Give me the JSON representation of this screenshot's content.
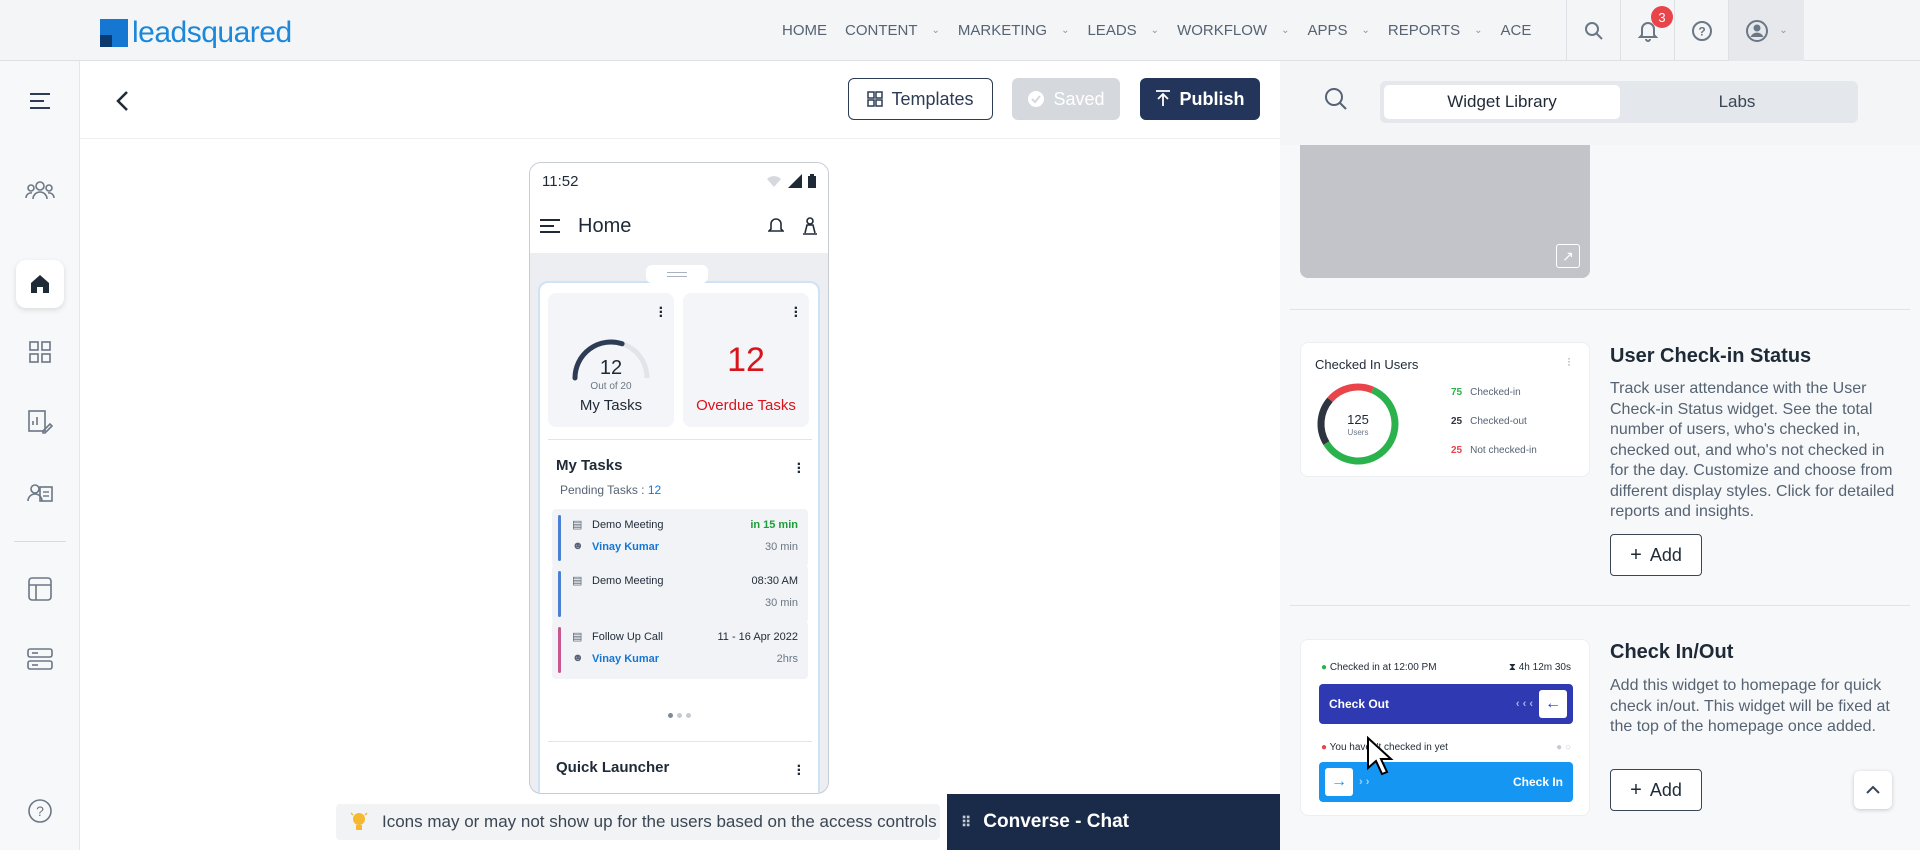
{
  "brand": {
    "name": "leadsquared"
  },
  "nav": {
    "items": [
      "HOME",
      "CONTENT",
      "MARKETING",
      "LEADS",
      "WORKFLOW",
      "APPS",
      "REPORTS",
      "ACE"
    ],
    "dropdown": [
      false,
      true,
      true,
      true,
      true,
      true,
      true,
      false
    ],
    "notification_count": "3"
  },
  "sidebar": {
    "items": [
      "menu-icon",
      "users-icon",
      "home-icon",
      "grid-icon",
      "chart-edit-icon",
      "contacts-icon",
      "layout-icon",
      "server-icon",
      "help-icon"
    ],
    "active": "home-icon"
  },
  "toolbar": {
    "templates": "Templates",
    "saved": "Saved",
    "publish": "Publish"
  },
  "phone": {
    "time": "11:52",
    "title": "Home",
    "my_tasks_card": {
      "value": "12",
      "sub": "Out of 20",
      "label": "My Tasks",
      "progress": 0.6
    },
    "overdue_card": {
      "value": "12",
      "label": "Overdue Tasks"
    },
    "tasks": {
      "title": "My Tasks",
      "pending_label": "Pending Tasks : ",
      "pending_value": "12",
      "items": [
        {
          "name": "Demo Meeting",
          "time": "in 15 min",
          "user": "Vinay Kumar",
          "duration": "30 min",
          "color": "#4a7fd4",
          "time_color": "#1e9e3a"
        },
        {
          "name": "Demo Meeting",
          "time": "08:30 AM",
          "user": "",
          "duration": "30 min",
          "color": "#4a7fd4",
          "time_color": "#1f2a37"
        },
        {
          "name": "Follow Up Call",
          "time": "11 - 16 Apr 2022",
          "user": "Vinay Kumar",
          "duration": "2hrs",
          "color": "#c9578f",
          "time_color": "#1f2a37"
        }
      ]
    },
    "quick_launcher": "Quick Launcher"
  },
  "hint": {
    "text": "Icons may or may not show up for the users based on the access controls"
  },
  "chat": {
    "label": "Converse - Chat"
  },
  "library": {
    "tabs": [
      "Widget Library",
      "Labs"
    ],
    "active_tab": "Widget Library",
    "widgets": [
      {
        "title": "User Check-in Status",
        "description": "Track user attendance with the User Check-in Status widget. See the total number of users, who's checked in, checked out, and who's not checked in for the day. Customize and choose from different display styles. Click for detailed reports and insights.",
        "add_label": "Add",
        "preview": {
          "title": "Checked In Users",
          "total": "125",
          "total_label": "Users",
          "legend": [
            {
              "value": "75",
              "label": "Checked-in",
              "color": "#2bb24c",
              "fraction": 0.6
            },
            {
              "value": "25",
              "label": "Checked-out",
              "color": "#2e3440",
              "fraction": 0.2
            },
            {
              "value": "25",
              "label": "Not checked-in",
              "color": "#e8444a",
              "fraction": 0.2
            }
          ]
        }
      },
      {
        "title": "Check In/Out",
        "description": "Add this widget to homepage for quick check in/out. This widget will be fixed at the top of the homepage once added.",
        "add_label": "Add",
        "preview": {
          "checked_in_text": "Checked in at 12:00 PM",
          "timer": "4h 12m 30s",
          "check_out": "Check Out",
          "not_checked_text": "You haven't checked in yet",
          "check_in": "Check In",
          "out_color": "#2f3ab2",
          "in_color": "#1596f2"
        }
      }
    ]
  }
}
